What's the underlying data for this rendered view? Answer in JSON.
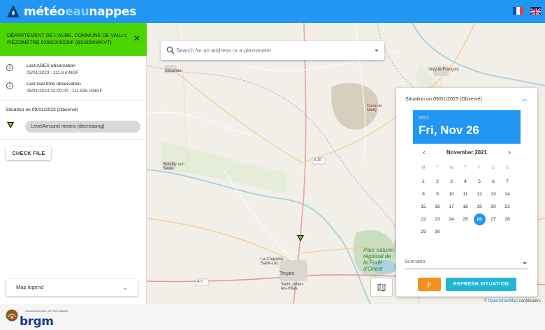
{
  "header": {
    "logo_part1": "météo",
    "logo_part2": "eau",
    "logo_part3": "nappes",
    "lang_fr": "FR",
    "lang_en": "EN"
  },
  "sidebar": {
    "site_title": "DÉPARTEMENT DE L'AUBE, COMMUNE DE VAILLY, PIÉZOMÈTRE 02982X0028/F (BSS000WKVT)",
    "last_ades_label": "Last ADES observation",
    "last_ades_value": "03/01/2023 : 111.8 mNGF",
    "last_rt_label": "Last real time observation",
    "last_rt_value": "09/01/2023 02:00:00 : 111.835 mNGF",
    "situation_label": "Situation on 09/01/2023 (Observé)",
    "level_chip": "LevelArround means (decreasing)",
    "check_file_label": "CHECK FILE",
    "map_legend_label": "Map legend"
  },
  "search": {
    "placeholder": "Search for an address or a piezometer"
  },
  "map": {
    "labels": {
      "sezanne": "Sézanne",
      "vitry": "Vitry-le-François",
      "camp": "Camp de Mailly",
      "romilly": "Romilly-sur-Seine",
      "a26": "A 26",
      "a5": "A 5",
      "chapelle": "La Chapelle-Saint-Luc",
      "troyes": "Troyes",
      "saintjulien": "Saint-Julien-les-Villas",
      "parc": "Parc naturel régional de la Forêt d'Orient"
    },
    "attribution_prefix": "©",
    "attribution_link": "OpenStreetMap",
    "attribution_suffix": "contributors"
  },
  "calendar": {
    "panel_title": "Situation on 09/01/2023 (Observé)",
    "year": "2021",
    "selected_date": "Fri, Nov 26",
    "month_label": "November 2021",
    "weekdays": [
      "M",
      "T",
      "W",
      "T",
      "F",
      "S",
      "S"
    ],
    "weeks": [
      [
        "1",
        "2",
        "3",
        "4",
        "5",
        "6",
        "7"
      ],
      [
        "8",
        "9",
        "10",
        "11",
        "12",
        "13",
        "14"
      ],
      [
        "15",
        "16",
        "17",
        "18",
        "19",
        "20",
        "21"
      ],
      [
        "22",
        "23",
        "24",
        "25",
        "26",
        "27",
        "28"
      ],
      [
        "29",
        "30"
      ]
    ],
    "selected_day": "26",
    "scenario_placeholder": "Scenario",
    "refresh_label": "REFRESH SITUATION"
  },
  "footer": {
    "brgm_tagline": "Géosciences pour une Terre durable",
    "brgm_name": "brgm"
  },
  "colors": {
    "header_blue": "#2196f3",
    "site_green": "#4cd600",
    "orange": "#f78f1e",
    "cyan": "#1eb7d8"
  }
}
